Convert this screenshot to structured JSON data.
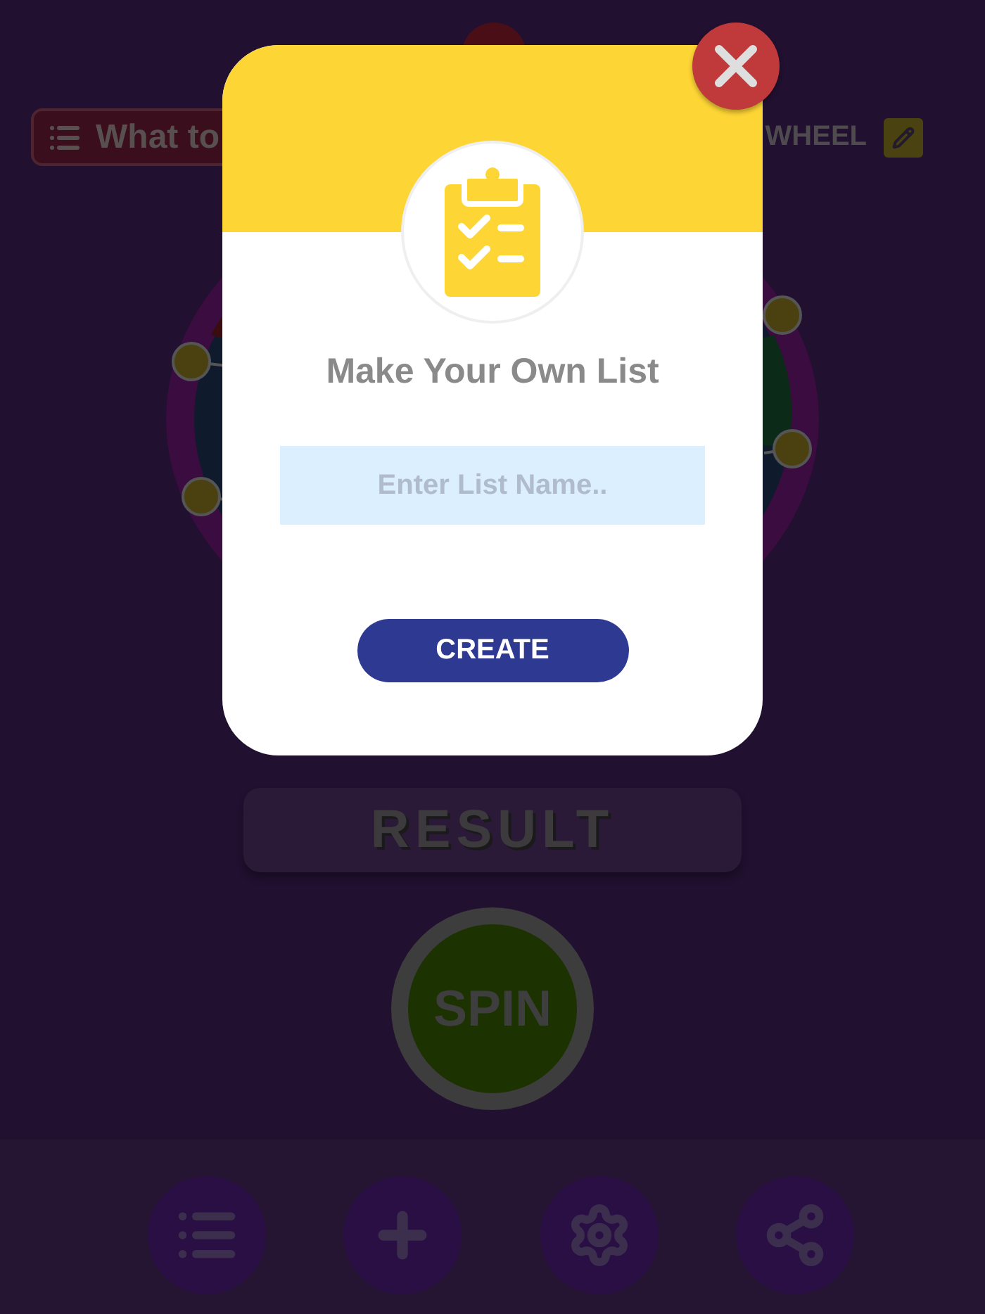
{
  "app": {
    "list_button": {
      "label": "What to"
    },
    "wheel_title": "WHEEL",
    "result": "RESULT",
    "spin_button": "SPIN",
    "nav": [
      {
        "kind": "list"
      },
      {
        "kind": "add"
      },
      {
        "kind": "settings"
      },
      {
        "kind": "share"
      }
    ]
  },
  "dialog": {
    "title": "Make Your Own List",
    "input": {
      "placeholder": "Enter List Name.."
    },
    "button": "CREATE"
  }
}
